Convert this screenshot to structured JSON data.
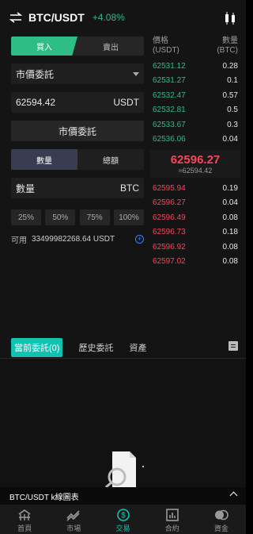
{
  "header": {
    "pair": "BTC/USDT",
    "change": "+4.08%"
  },
  "trade": {
    "tab_buy": "買入",
    "tab_sell": "賣出",
    "order_type": "市價委託",
    "price_value": "62594.42",
    "price_unit": "USDT",
    "market_button": "市價委託",
    "seg_quantity": "數量",
    "seg_turnover": "總額",
    "amount_label": "數量",
    "amount_unit": "BTC",
    "percents": [
      "25%",
      "50%",
      "75%",
      "100%"
    ],
    "available_label": "可用",
    "available_value": "33499982268.64 USDT"
  },
  "orderbook": {
    "price_header": "價格",
    "price_unit": "(USDT)",
    "qty_header": "數量",
    "qty_unit": "(BTC)",
    "bids_top": [
      {
        "price": "62531.12",
        "qty": "0.28"
      },
      {
        "price": "62531.27",
        "qty": "0.1"
      },
      {
        "price": "62532.47",
        "qty": "0.57"
      },
      {
        "price": "62532.81",
        "qty": "0.5"
      },
      {
        "price": "62533.67",
        "qty": "0.3"
      },
      {
        "price": "62536.06",
        "qty": "0.04"
      }
    ],
    "last_price": "62596.27",
    "ref_price": "≈62594.42",
    "asks": [
      {
        "price": "62595.94",
        "qty": "0.19"
      },
      {
        "price": "62596.27",
        "qty": "0.04"
      },
      {
        "price": "62596.49",
        "qty": "0.08"
      },
      {
        "price": "62596.73",
        "qty": "0.18"
      },
      {
        "price": "62596.92",
        "qty": "0.08"
      },
      {
        "price": "62597.02",
        "qty": "0.08"
      }
    ]
  },
  "orders": {
    "tab_current": "當前委託(0)",
    "tab_history": "歷史委託",
    "tab_assets": "資產"
  },
  "kline_bar": {
    "label": "BTC/USDT k線圖表"
  },
  "nav": [
    {
      "label": "首頁",
      "icon": "home-icon"
    },
    {
      "label": "市場",
      "icon": "market-icon"
    },
    {
      "label": "交易",
      "icon": "trade-icon"
    },
    {
      "label": "合約",
      "icon": "contract-icon"
    },
    {
      "label": "資金",
      "icon": "funds-icon"
    }
  ],
  "colors": {
    "green": "#2ebd85",
    "red": "#f6465d",
    "teal": "#10c2b0"
  }
}
